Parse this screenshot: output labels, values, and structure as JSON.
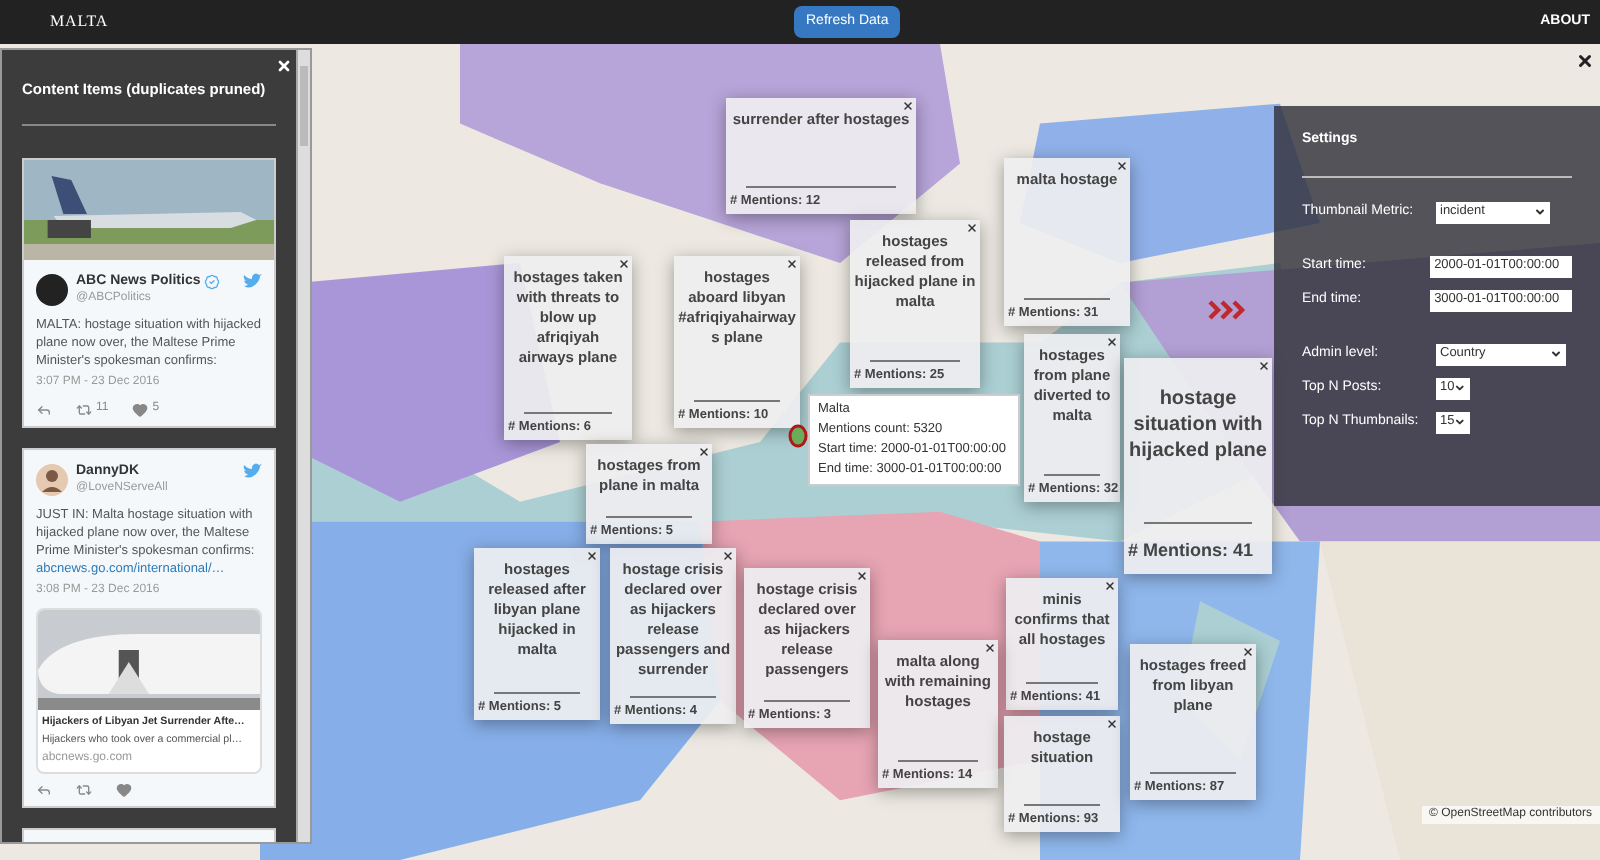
{
  "top_bar": {
    "title": "MALTA",
    "refresh_button": "Refresh Data",
    "about_link": "ABOUT"
  },
  "content_panel": {
    "title": "Content Items (duplicates pruned)",
    "tweets": [
      {
        "name": "ABC News Politics",
        "verified": true,
        "handle": "@ABCPolitics",
        "text": "MALTA: hostage situation with hijacked plane now over, the Maltese Prime Minister's spokesman confirms:",
        "time": "3:07 PM - 23 Dec 2016",
        "retweets": "11",
        "likes": "5"
      },
      {
        "kind": "link_card",
        "name": "DannyDK",
        "verified": false,
        "handle": "@LoveNServeAll",
        "text": "JUST IN: Malta hostage situation with hijacked plane now over, the Maltese Prime Minister's spokesman confirms:",
        "link": "abcnews.go.com/international/…",
        "time": "3:08 PM - 23 Dec 2016",
        "card_title": "Hijackers of Libyan Jet Surrender Afte…",
        "card_text": "Hijackers who took over a commercial pl…",
        "card_domain": "abcnews.go.com"
      }
    ]
  },
  "thumbnails": [
    {
      "kind": "small",
      "title": "surrender after hostages",
      "mentions": "# Mentions: 12"
    },
    {
      "kind": "small",
      "title": "hostages taken with threats to blow up afriqiyah airways plane",
      "mentions": "# Mentions: 6"
    },
    {
      "kind": "small",
      "title": "hostages aboard libyan #afriqiyahairways plane",
      "mentions": "# Mentions: 10"
    },
    {
      "kind": "small",
      "title": "hostages released from hijacked plane in malta",
      "mentions": "# Mentions: 25"
    },
    {
      "kind": "small",
      "title": "malta hostage",
      "mentions": "# Mentions: 31"
    },
    {
      "kind": "small",
      "title": "hostages from plane in malta",
      "mentions": "# Mentions: 5"
    },
    {
      "kind": "small",
      "title": "hostages from plane diverted to malta",
      "mentions": "# Mentions: 32"
    },
    {
      "kind": "small",
      "title": "minis confirms that all hostages",
      "mentions": "# Mentions: 41"
    },
    {
      "kind": "large",
      "title": "hostage situation with hijacked plane",
      "mentions": "# Mentions: 41"
    },
    {
      "kind": "small",
      "title": "hostages released after libyan plane hijacked in malta",
      "mentions": "# Mentions: 5"
    },
    {
      "kind": "small",
      "title": "hostage crisis declared over as hijackers release passengers and surrender",
      "mentions": "# Mentions: 4"
    },
    {
      "kind": "small",
      "title": "hostage crisis declared over as hijackers release passengers",
      "mentions": "# Mentions: 3"
    },
    {
      "kind": "small",
      "title": "malta along with remaining hostages",
      "mentions": "# Mentions: 14"
    },
    {
      "kind": "small",
      "title": "hostage situation",
      "mentions": "# Mentions: 93"
    },
    {
      "kind": "small",
      "title": "hostages freed from libyan plane",
      "mentions": "# Mentions: 87"
    }
  ],
  "tooltip": {
    "name": "Malta",
    "lines": [
      "Mentions count: 5320",
      "Start time: 2000-01-01T00:00:00",
      "End time: 3000-01-01T00:00:00"
    ]
  },
  "settings": {
    "title": "Settings",
    "fields": [
      {
        "kind": "select",
        "label": "Thumbnail Metric:",
        "value": "incident"
      },
      {
        "kind": "input",
        "label": "Start time:",
        "value": "2000-01-01T00:00:00"
      },
      {
        "kind": "input",
        "label": "End time:",
        "value": "3000-01-01T00:00:00"
      },
      {
        "kind": "select",
        "label": "Admin level:",
        "value": "Country"
      },
      {
        "kind": "small_select",
        "label": "Top N Posts:",
        "value": "10"
      },
      {
        "kind": "small_select",
        "label": "Top N Thumbnails:",
        "value": "15"
      }
    ]
  },
  "attribution": "© OpenStreetMap contributors"
}
